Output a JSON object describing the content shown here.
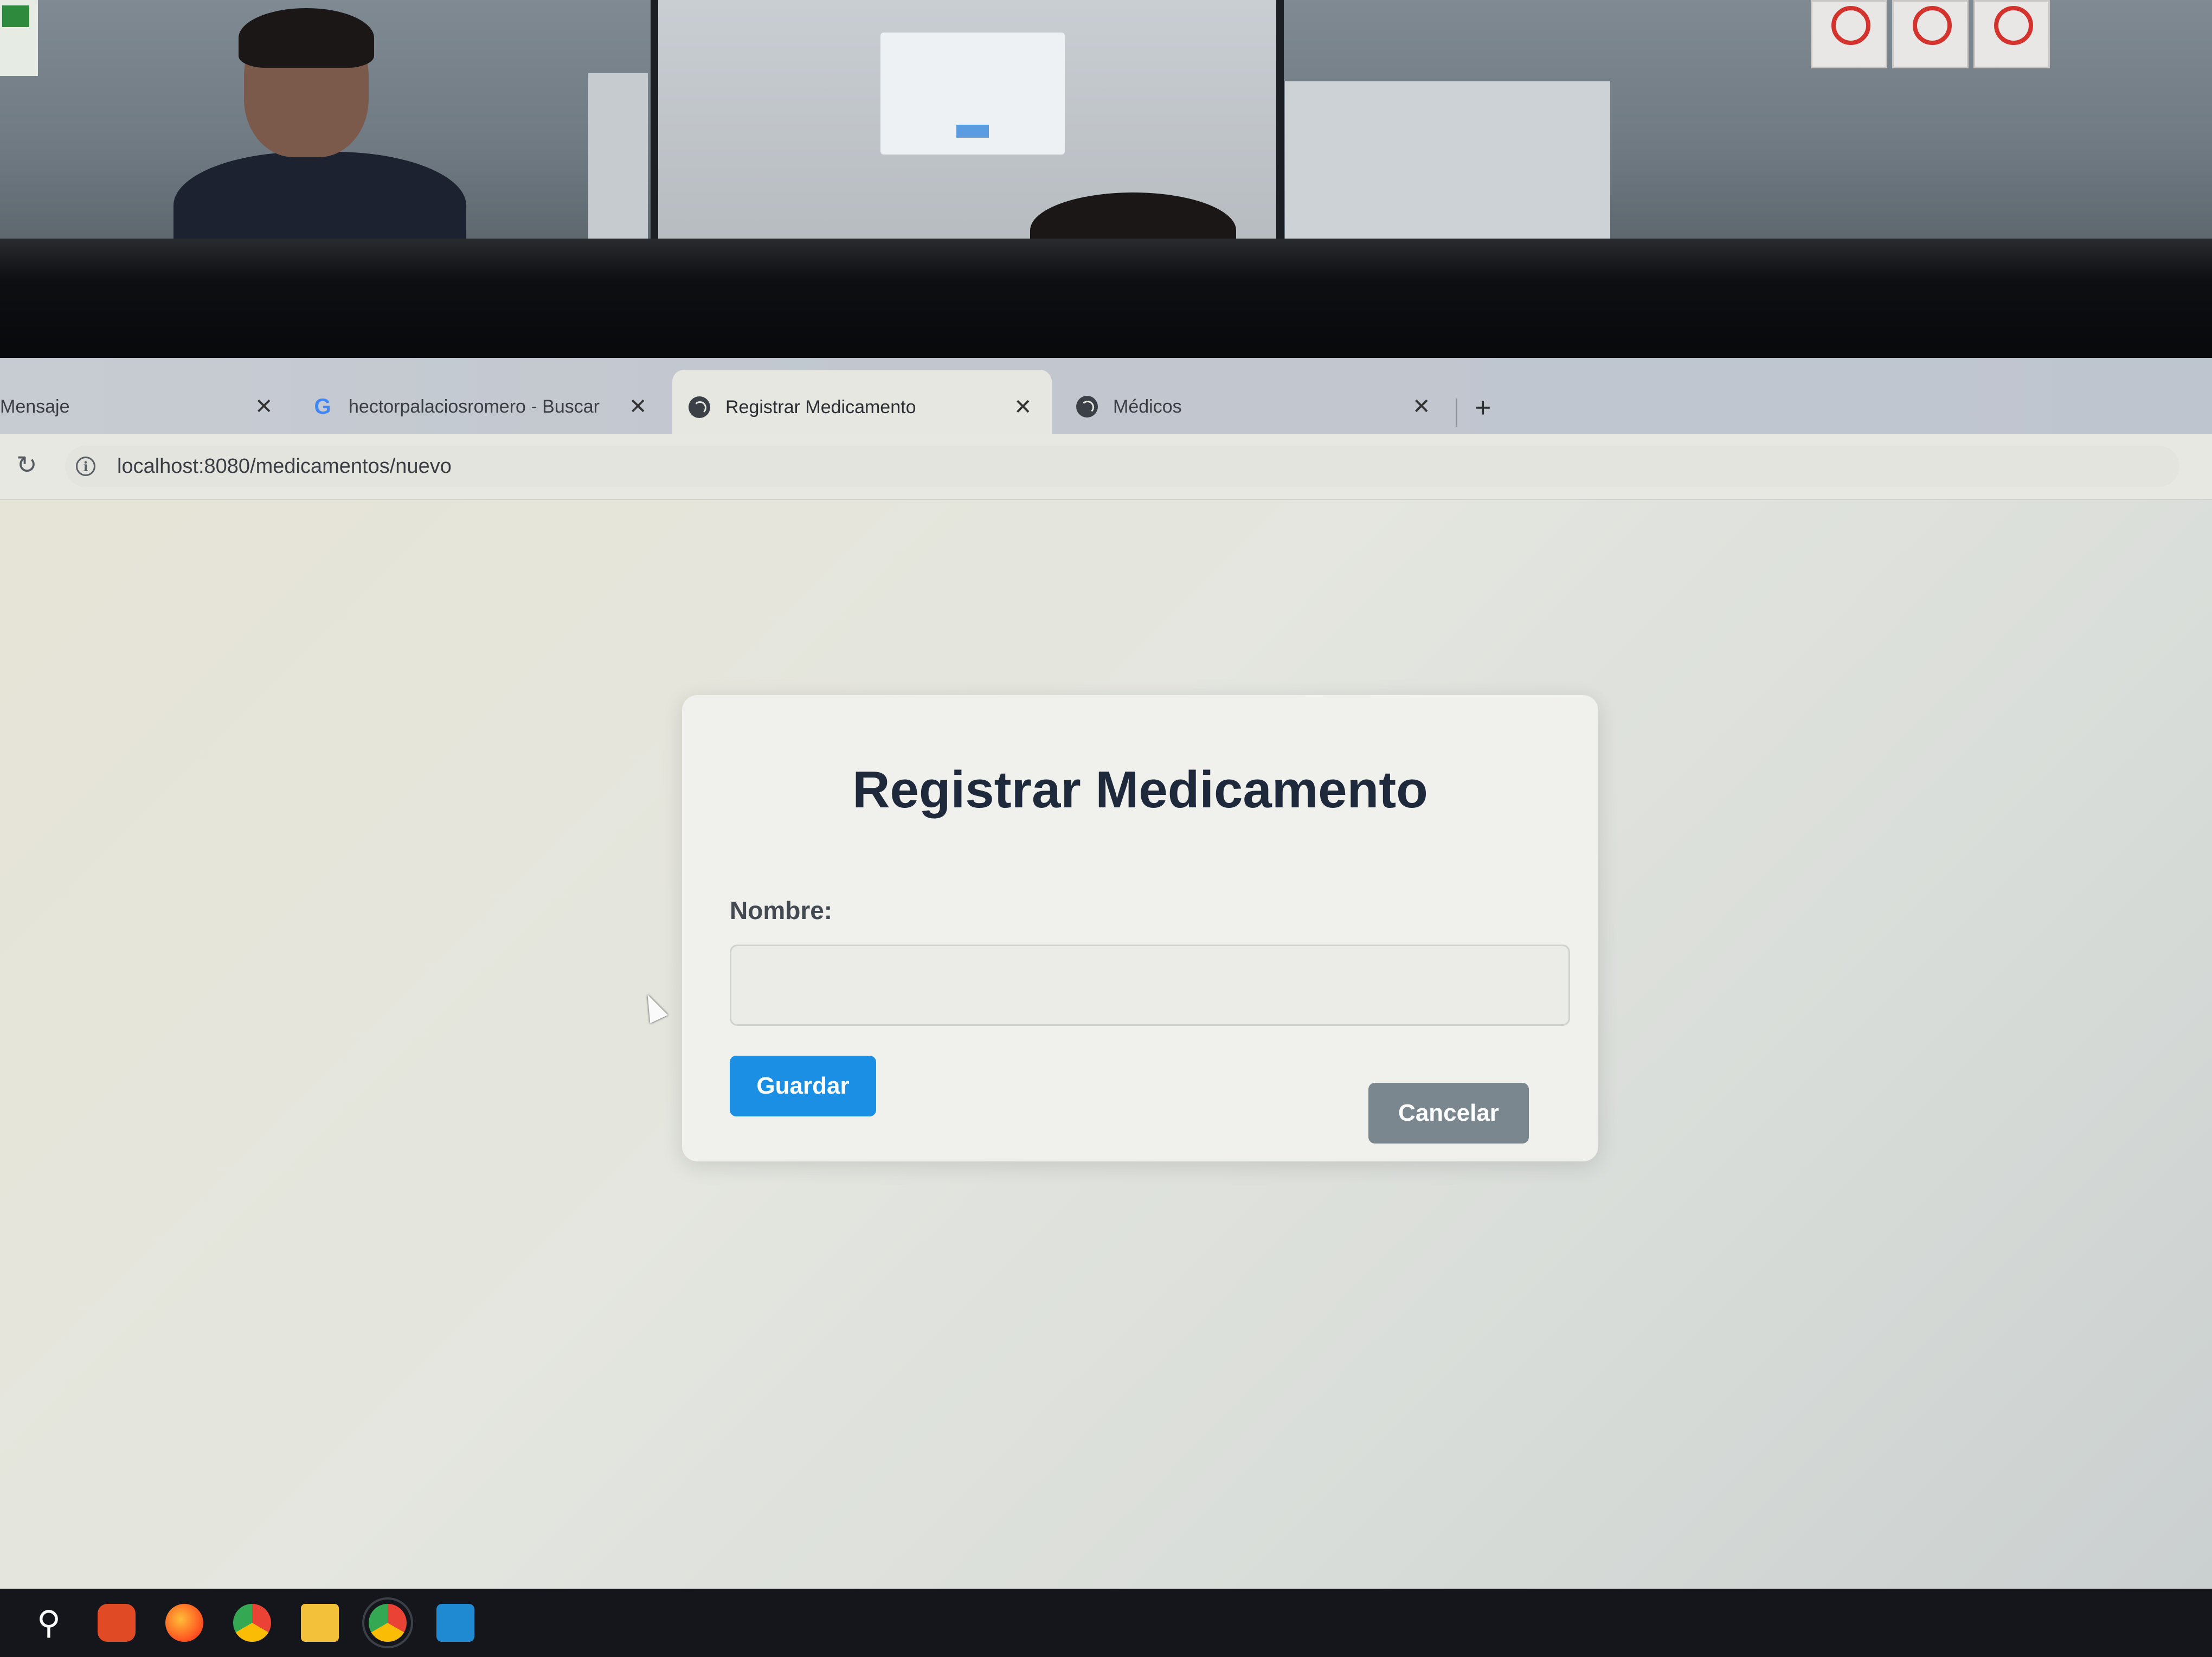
{
  "browser": {
    "tabs": [
      {
        "title": "Mensaje",
        "favicon": "none",
        "active": false
      },
      {
        "title": "hectorpalaciosromero - Buscar",
        "favicon": "google-icon",
        "active": false
      },
      {
        "title": "Registrar Medicamento",
        "favicon": "globe-icon",
        "active": true
      },
      {
        "title": "Médicos",
        "favicon": "globe-icon",
        "active": false
      }
    ],
    "close_glyph": "✕",
    "new_tab_glyph": "+",
    "reload_glyph": "↻",
    "info_glyph": "i",
    "google_glyph": "G",
    "url": "localhost:8080/medicamentos/nuevo"
  },
  "form": {
    "title": "Registrar Medicamento",
    "nombre_label": "Nombre:",
    "nombre_value": "",
    "save_label": "Guardar",
    "cancel_label": "Cancelar"
  },
  "taskbar": {
    "icons": [
      "search-icon",
      "brave-icon",
      "firefox-icon",
      "chrome-icon",
      "file-explorer-icon",
      "chrome-icon",
      "vscode-icon"
    ],
    "search_glyph": "⚲"
  },
  "colors": {
    "primary_button": "#1a8fe3",
    "secondary_button": "#7b878e",
    "title_text": "#1e2a3b"
  }
}
